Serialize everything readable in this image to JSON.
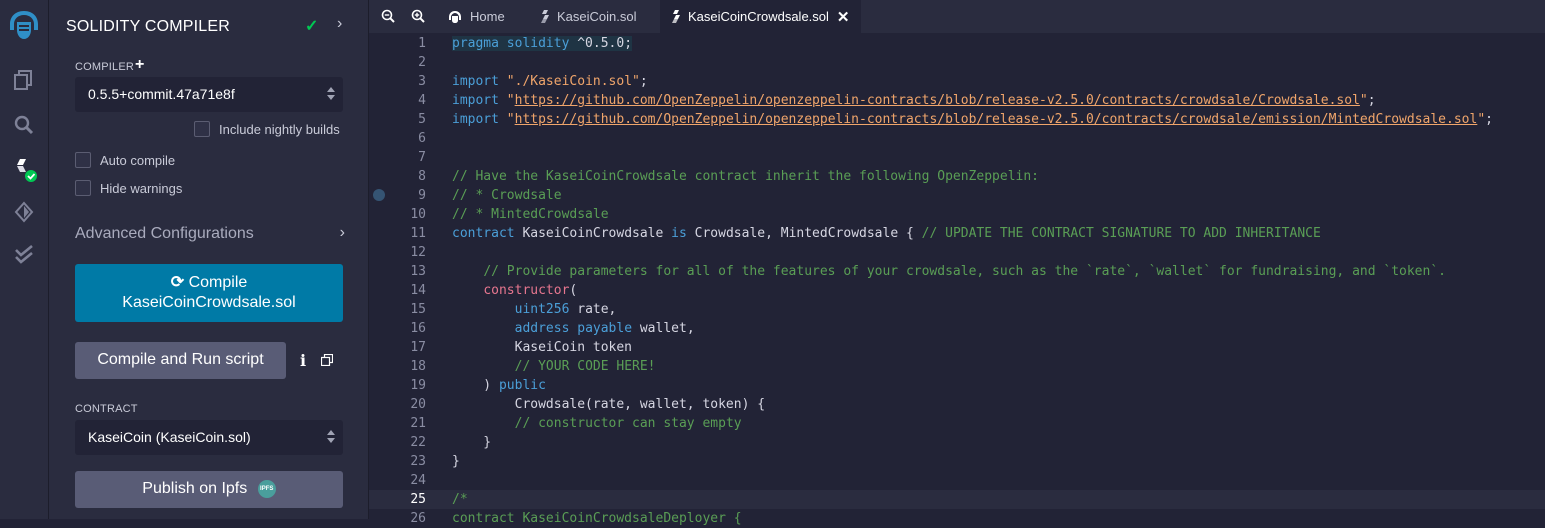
{
  "panel": {
    "title": "SOLIDITY COMPILER",
    "compiler_label": "COMPILER",
    "compiler_version": "0.5.5+commit.47a71e8f",
    "include_nightly": "Include nightly builds",
    "auto_compile": "Auto compile",
    "hide_warnings": "Hide warnings",
    "advanced": "Advanced Configurations",
    "compile_line1": "Compile",
    "compile_line2": "KaseiCoinCrowdsale.sol",
    "compile_run": "Compile and Run script",
    "contract_label": "CONTRACT",
    "contract_value": "KaseiCoin (KaseiCoin.sol)",
    "publish": "Publish on Ipfs",
    "ipfs_badge": "IPFS"
  },
  "tabs": [
    {
      "label": "Home"
    },
    {
      "label": "KaseiCoin.sol"
    },
    {
      "label": "KaseiCoinCrowdsale.sol"
    }
  ],
  "colors": {
    "accent_button": "#007aa6",
    "success_check": "#00c853",
    "editor_bg": "#222336",
    "panel_bg": "#2a2c3f"
  },
  "rail_icons": [
    "remix-logo-icon",
    "file-explorer-icon",
    "search-icon",
    "solidity-compiler-icon",
    "deploy-run-icon",
    "testing-icon"
  ],
  "editor": {
    "current_line": 25,
    "breakpoint_line": 9,
    "lines": [
      {
        "n": "1",
        "parts": [
          [
            "k",
            "pragma solidity "
          ],
          [
            "t",
            "^0.5.0;"
          ]
        ],
        "hl": true
      },
      {
        "n": "2",
        "parts": []
      },
      {
        "n": "3",
        "parts": [
          [
            "k",
            "import "
          ],
          [
            "s",
            "\"./KaseiCoin.sol\""
          ],
          [
            "t",
            ";"
          ]
        ]
      },
      {
        "n": "4",
        "parts": [
          [
            "k",
            "import "
          ],
          [
            "s",
            "\""
          ],
          [
            "u",
            "https://github.com/OpenZeppelin/openzeppelin-contracts/blob/release-v2.5.0/contracts/crowdsale/Crowdsale.sol"
          ],
          [
            "s",
            "\""
          ],
          [
            "t",
            ";"
          ]
        ]
      },
      {
        "n": "5",
        "parts": [
          [
            "k",
            "import "
          ],
          [
            "s",
            "\""
          ],
          [
            "u",
            "https://github.com/OpenZeppelin/openzeppelin-contracts/blob/release-v2.5.0/contracts/crowdsale/emission/MintedCrowdsale.sol"
          ],
          [
            "s",
            "\""
          ],
          [
            "t",
            ";"
          ]
        ]
      },
      {
        "n": "6",
        "parts": []
      },
      {
        "n": "7",
        "parts": []
      },
      {
        "n": "8",
        "parts": [
          [
            "c",
            "// Have the KaseiCoinCrowdsale contract inherit the following OpenZeppelin:"
          ]
        ]
      },
      {
        "n": "9",
        "parts": [
          [
            "c",
            "// * Crowdsale"
          ]
        ]
      },
      {
        "n": "10",
        "parts": [
          [
            "c",
            "// * MintedCrowdsale"
          ]
        ]
      },
      {
        "n": "11",
        "parts": [
          [
            "k",
            "contract "
          ],
          [
            "t",
            "KaseiCoinCrowdsale "
          ],
          [
            "k",
            "is "
          ],
          [
            "t",
            "Crowdsale, MintedCrowdsale { "
          ],
          [
            "c",
            "// UPDATE THE CONTRACT SIGNATURE TO ADD INHERITANCE"
          ]
        ]
      },
      {
        "n": "12",
        "parts": []
      },
      {
        "n": "13",
        "parts": [
          [
            "t",
            "    "
          ],
          [
            "c",
            "// Provide parameters for all of the features of your crowdsale, such as the `rate`, `wallet` for fundraising, and `token`."
          ]
        ]
      },
      {
        "n": "14",
        "parts": [
          [
            "t",
            "    "
          ],
          [
            "ctor",
            "constructor"
          ],
          [
            "t",
            "("
          ]
        ]
      },
      {
        "n": "15",
        "parts": [
          [
            "t",
            "        "
          ],
          [
            "k",
            "uint256 "
          ],
          [
            "t",
            "rate,"
          ]
        ]
      },
      {
        "n": "16",
        "parts": [
          [
            "t",
            "        "
          ],
          [
            "k",
            "address payable "
          ],
          [
            "t",
            "wallet,"
          ]
        ]
      },
      {
        "n": "17",
        "parts": [
          [
            "t",
            "        KaseiCoin token"
          ]
        ]
      },
      {
        "n": "18",
        "parts": [
          [
            "t",
            "        "
          ],
          [
            "c",
            "// YOUR CODE HERE!"
          ]
        ]
      },
      {
        "n": "19",
        "parts": [
          [
            "t",
            "    ) "
          ],
          [
            "k",
            "public"
          ]
        ]
      },
      {
        "n": "20",
        "parts": [
          [
            "t",
            "        Crowdsale(rate, wallet, token) {"
          ]
        ]
      },
      {
        "n": "21",
        "parts": [
          [
            "t",
            "        "
          ],
          [
            "c",
            "// constructor can stay empty"
          ]
        ]
      },
      {
        "n": "22",
        "parts": [
          [
            "t",
            "    }"
          ]
        ]
      },
      {
        "n": "23",
        "parts": [
          [
            "t",
            "}"
          ]
        ]
      },
      {
        "n": "24",
        "parts": []
      },
      {
        "n": "25",
        "parts": [
          [
            "c",
            "/*"
          ]
        ]
      },
      {
        "n": "26",
        "parts": [
          [
            "c",
            "contract KaseiCoinCrowdsaleDeployer {"
          ]
        ]
      }
    ]
  }
}
